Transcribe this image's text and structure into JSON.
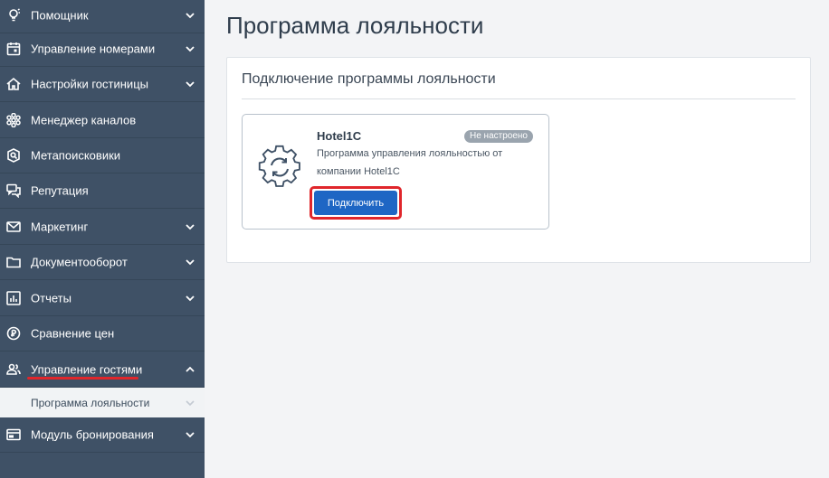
{
  "sidebar": {
    "items": [
      {
        "label": "Помощник",
        "icon": "lightbulb-icon",
        "chevron": "down"
      },
      {
        "label": "Управление номерами",
        "icon": "calendar-icon",
        "chevron": "down"
      },
      {
        "label": "Настройки гостиницы",
        "icon": "home-icon",
        "chevron": "down"
      },
      {
        "label": "Менеджер каналов",
        "icon": "channels-icon",
        "chevron": ""
      },
      {
        "label": "Метапоисковики",
        "icon": "metasearch-icon",
        "chevron": ""
      },
      {
        "label": "Репутация",
        "icon": "chat-icon",
        "chevron": ""
      },
      {
        "label": "Маркетинг",
        "icon": "mail-icon",
        "chevron": "down"
      },
      {
        "label": "Документооборот",
        "icon": "folder-icon",
        "chevron": "down"
      },
      {
        "label": "Отчеты",
        "icon": "bar-chart-icon",
        "chevron": "down"
      },
      {
        "label": "Сравнение цен",
        "icon": "price-compare-icon",
        "chevron": ""
      },
      {
        "label": "Управление гостями",
        "icon": "guests-icon",
        "chevron": "up"
      },
      {
        "label": "Модуль бронирования",
        "icon": "booking-icon",
        "chevron": "down"
      }
    ],
    "subitem": {
      "label": "Программа лояльности"
    }
  },
  "main": {
    "page_title": "Программа лояльности",
    "panel_title": "Подключение программы лояльности",
    "card": {
      "name": "Hotel1C",
      "status": "Не настроено",
      "description": "Программа управления лояльностью от компании Hotel1C",
      "button_label": "Подключить",
      "icon": "sync-gear-icon"
    }
  },
  "colors": {
    "sidebar_bg": "#3f5166",
    "accent_blue": "#1e66c4",
    "highlight_red": "#e0262b",
    "badge_gray": "#9aa4ae"
  }
}
